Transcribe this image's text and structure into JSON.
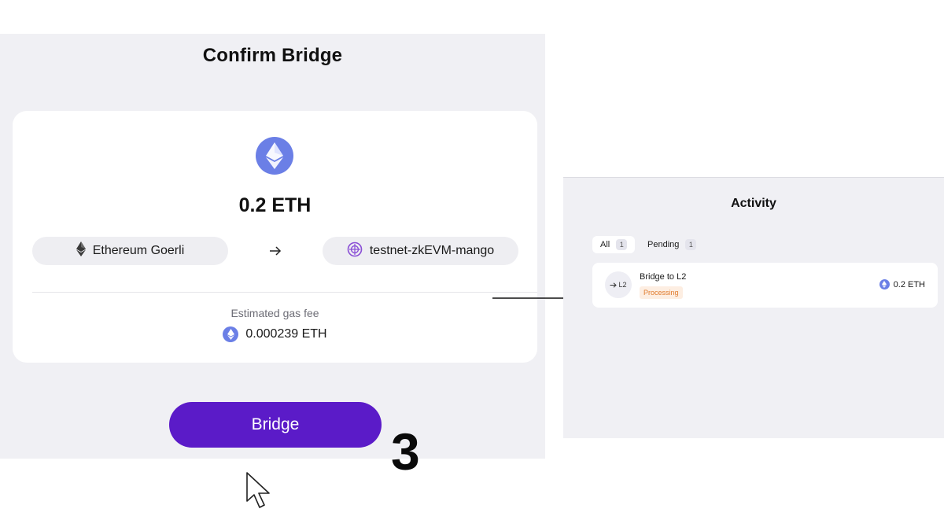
{
  "confirm": {
    "title": "Confirm Bridge",
    "amount": "0.2 ETH",
    "from_chain": "Ethereum Goerli",
    "to_chain": "testnet-zkEVM-mango",
    "gas_label": "Estimated gas fee",
    "gas_value": "0.000239 ETH",
    "bridge_label": "Bridge",
    "step_number": "3"
  },
  "activity": {
    "title": "Activity",
    "tabs": [
      {
        "label": "All",
        "count": "1"
      },
      {
        "label": "Pending",
        "count": "1"
      }
    ],
    "items": [
      {
        "icon_text": "L2",
        "title": "Bridge to L2",
        "status": "Processing",
        "amount": "0.2 ETH"
      }
    ]
  },
  "colors": {
    "accent": "#5b1bc8",
    "eth_blue": "#6b7fe6",
    "panel_bg": "#f0f0f4",
    "processing": "#e07a2b"
  },
  "icons": [
    "eth-icon",
    "ethereum-diamond-icon",
    "zkevm-icon",
    "arrow-right-icon",
    "cursor-icon"
  ]
}
